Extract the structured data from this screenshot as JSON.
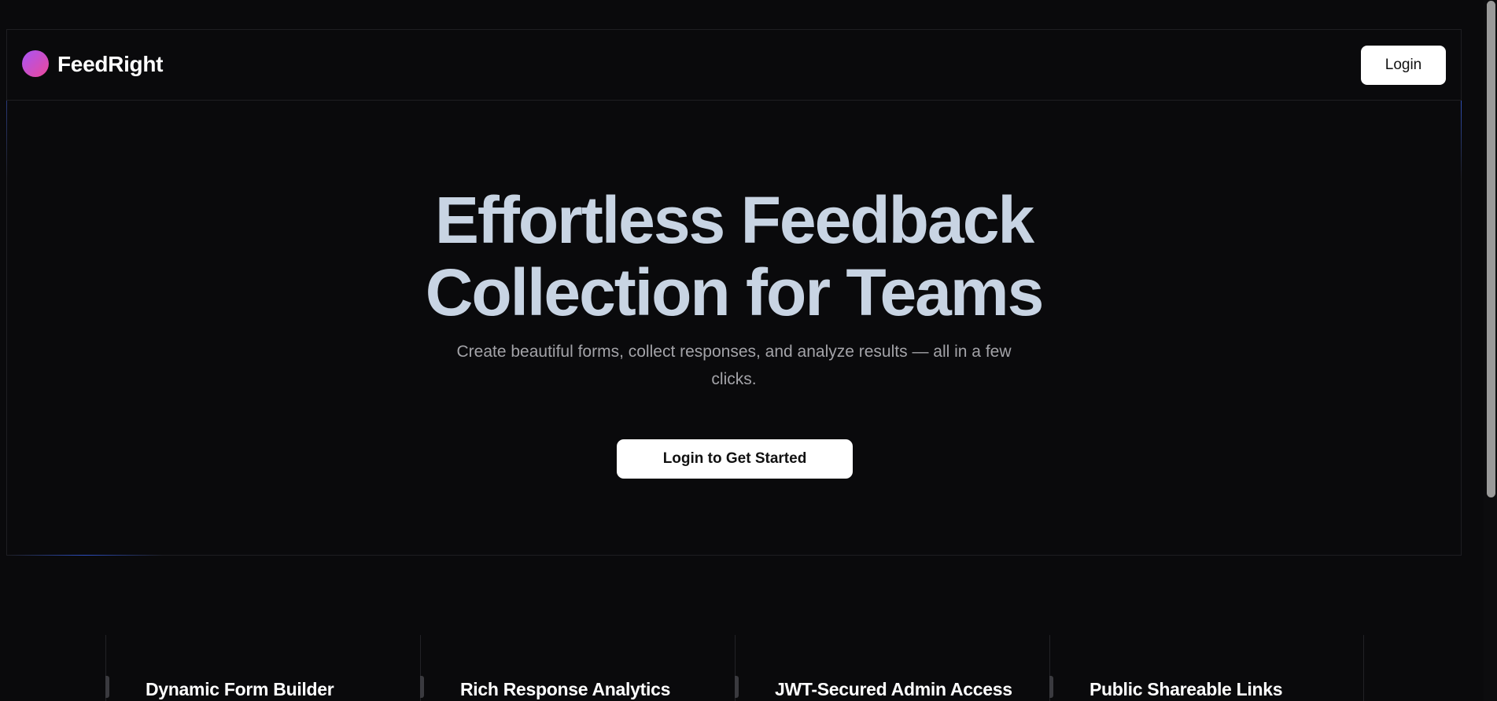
{
  "navbar": {
    "brand": "FeedRight",
    "login_label": "Login"
  },
  "hero": {
    "title_line1": "Effortless Feedback",
    "title_line2": "Collection for Teams",
    "subtitle": "Create beautiful forms, collect responses, and analyze results — all in a few clicks.",
    "cta_label": "Login to Get Started"
  },
  "features": [
    {
      "title": "Dynamic Form Builder"
    },
    {
      "title": "Rich Response Analytics"
    },
    {
      "title": "JWT-Secured Admin Access"
    },
    {
      "title": "Public Shareable Links"
    }
  ],
  "colors": {
    "background": "#0a0a0c",
    "logo_gradient_start": "#a855f7",
    "logo_gradient_end": "#ec4899",
    "title_text": "#c8d4e3",
    "button_bg": "#ffffff"
  }
}
